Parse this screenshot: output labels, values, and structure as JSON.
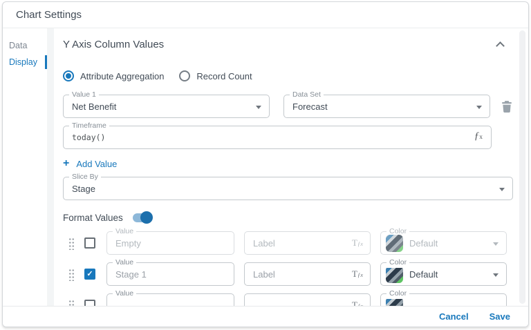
{
  "colors": {
    "accent": "#1878bc",
    "text_dark": "#414b56",
    "text_muted": "#9ba1a8",
    "border": "#c3c8cc"
  },
  "dialog": {
    "title": "Chart Settings"
  },
  "sidebar": {
    "items": [
      {
        "label": "Data",
        "active": false
      },
      {
        "label": "Display",
        "active": true
      }
    ]
  },
  "section": {
    "title": "Y Axis Column Values",
    "collapse_icon": "chevron-up"
  },
  "aggregation_mode": {
    "options": [
      {
        "label": "Attribute Aggregation",
        "selected": true
      },
      {
        "label": "Record Count",
        "selected": false
      }
    ]
  },
  "value1": {
    "label": "Value 1",
    "value": "Net Benefit"
  },
  "dataset": {
    "label": "Data Set",
    "value": "Forecast"
  },
  "timeframe": {
    "label": "Timeframe",
    "value": "today()"
  },
  "add_value": {
    "plus": "+",
    "label": "Add Value"
  },
  "slice_by": {
    "label": "Slice By",
    "value": "Stage"
  },
  "format_values": {
    "label": "Format Values",
    "toggle_on": true,
    "rows": [
      {
        "checked": false,
        "disabled": true,
        "value_label": "Value",
        "value": "Empty",
        "label_label": "Label",
        "color_label": "Color",
        "color_value": "Default"
      },
      {
        "checked": true,
        "disabled": false,
        "value_label": "Value",
        "value": "Stage 1",
        "label_label": "Label",
        "color_label": "Color",
        "color_value": "Default"
      },
      {
        "value_label": "Value",
        "color_label": "Color"
      }
    ]
  },
  "icons": {
    "fx_main": "ƒ",
    "fx_sub": "x",
    "tfx_main": "T",
    "tfx_sub": "ƒx",
    "check": "✓"
  },
  "footer": {
    "cancel_label": "Cancel",
    "save_label": "Save"
  }
}
